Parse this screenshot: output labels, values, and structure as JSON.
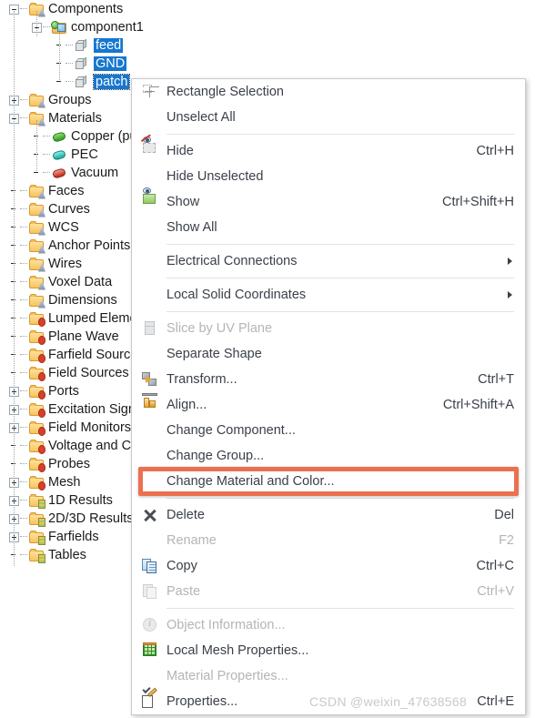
{
  "tree": {
    "items": [
      {
        "label": "Components",
        "indent": 0,
        "expander": "minus",
        "icon": "folder-cone",
        "selected": false
      },
      {
        "label": "component1",
        "indent": 1,
        "expander": "minus",
        "icon": "folder-component",
        "selected": false
      },
      {
        "label": "feed",
        "indent": 2,
        "expander": "none",
        "icon": "solid-cube",
        "selected": true
      },
      {
        "label": "GND",
        "indent": 2,
        "expander": "none",
        "icon": "solid-cube",
        "selected": true
      },
      {
        "label": "patch",
        "indent": 2,
        "expander": "none",
        "icon": "solid-cube",
        "selected": true,
        "focused": true
      },
      {
        "label": "Groups",
        "indent": 0,
        "expander": "plus",
        "icon": "folder-cone",
        "selected": false
      },
      {
        "label": "Materials",
        "indent": 0,
        "expander": "minus",
        "icon": "folder-cone",
        "selected": false
      },
      {
        "label": "Copper (pu",
        "indent": 1,
        "expander": "none",
        "icon": "material-green",
        "selected": false
      },
      {
        "label": "PEC",
        "indent": 1,
        "expander": "none",
        "icon": "material-teal",
        "selected": false
      },
      {
        "label": "Vacuum",
        "indent": 1,
        "expander": "none",
        "icon": "material-red",
        "selected": false
      },
      {
        "label": "Faces",
        "indent": 0,
        "expander": "none",
        "icon": "folder-cone",
        "selected": false
      },
      {
        "label": "Curves",
        "indent": 0,
        "expander": "none",
        "icon": "folder-cone",
        "selected": false
      },
      {
        "label": "WCS",
        "indent": 0,
        "expander": "none",
        "icon": "folder-cone",
        "selected": false
      },
      {
        "label": "Anchor Points",
        "indent": 0,
        "expander": "none",
        "icon": "folder-cone",
        "selected": false
      },
      {
        "label": "Wires",
        "indent": 0,
        "expander": "none",
        "icon": "folder-cone",
        "selected": false
      },
      {
        "label": "Voxel Data",
        "indent": 0,
        "expander": "none",
        "icon": "folder-cone",
        "selected": false
      },
      {
        "label": "Dimensions",
        "indent": 0,
        "expander": "none",
        "icon": "folder-cone",
        "selected": false
      },
      {
        "label": "Lumped Eleme",
        "indent": 0,
        "expander": "none",
        "icon": "folder-gear",
        "selected": false
      },
      {
        "label": "Plane Wave",
        "indent": 0,
        "expander": "none",
        "icon": "folder-gear",
        "selected": false
      },
      {
        "label": "Farfield Source",
        "indent": 0,
        "expander": "none",
        "icon": "folder-gear",
        "selected": false
      },
      {
        "label": "Field Sources",
        "indent": 0,
        "expander": "none",
        "icon": "folder-gear",
        "selected": false
      },
      {
        "label": "Ports",
        "indent": 0,
        "expander": "plus",
        "icon": "folder-gear",
        "selected": false
      },
      {
        "label": "Excitation Sign",
        "indent": 0,
        "expander": "plus",
        "icon": "folder-gear",
        "selected": false
      },
      {
        "label": "Field Monitors",
        "indent": 0,
        "expander": "plus",
        "icon": "folder-gear",
        "selected": false
      },
      {
        "label": "Voltage and C",
        "indent": 0,
        "expander": "none",
        "icon": "folder-gear",
        "selected": false
      },
      {
        "label": "Probes",
        "indent": 0,
        "expander": "none",
        "icon": "folder-gear",
        "selected": false
      },
      {
        "label": "Mesh",
        "indent": 0,
        "expander": "plus",
        "icon": "folder-gear",
        "selected": false
      },
      {
        "label": "1D Results",
        "indent": 0,
        "expander": "plus",
        "icon": "folder-wave",
        "selected": false
      },
      {
        "label": "2D/3D Results",
        "indent": 0,
        "expander": "plus",
        "icon": "folder-wave",
        "selected": false
      },
      {
        "label": "Farfields",
        "indent": 0,
        "expander": "plus",
        "icon": "folder-wave",
        "selected": false
      },
      {
        "label": "Tables",
        "indent": 0,
        "expander": "none",
        "icon": "folder-wave",
        "selected": false
      }
    ]
  },
  "context_menu": {
    "items": [
      {
        "kind": "item",
        "label": "Rectangle Selection",
        "shortcut": "",
        "icon": "rectangle-selection-icon",
        "disabled": false,
        "submenu": false
      },
      {
        "kind": "item",
        "label": "Unselect All",
        "shortcut": "",
        "icon": "",
        "disabled": false,
        "submenu": false
      },
      {
        "kind": "separator"
      },
      {
        "kind": "item",
        "label": "Hide",
        "shortcut": "Ctrl+H",
        "icon": "hide-icon",
        "disabled": false,
        "submenu": false
      },
      {
        "kind": "item",
        "label": "Hide Unselected",
        "shortcut": "",
        "icon": "",
        "disabled": false,
        "submenu": false
      },
      {
        "kind": "item",
        "label": "Show",
        "shortcut": "Ctrl+Shift+H",
        "icon": "show-icon",
        "disabled": false,
        "submenu": false
      },
      {
        "kind": "item",
        "label": "Show All",
        "shortcut": "",
        "icon": "",
        "disabled": false,
        "submenu": false
      },
      {
        "kind": "separator"
      },
      {
        "kind": "item",
        "label": "Electrical Connections",
        "shortcut": "",
        "icon": "",
        "disabled": false,
        "submenu": true
      },
      {
        "kind": "separator"
      },
      {
        "kind": "item",
        "label": "Local Solid Coordinates",
        "shortcut": "",
        "icon": "",
        "disabled": false,
        "submenu": true
      },
      {
        "kind": "separator"
      },
      {
        "kind": "item",
        "label": "Slice by UV Plane",
        "shortcut": "",
        "icon": "slice-icon",
        "disabled": true,
        "submenu": false
      },
      {
        "kind": "item",
        "label": "Separate Shape",
        "shortcut": "",
        "icon": "",
        "disabled": false,
        "submenu": false
      },
      {
        "kind": "item",
        "label": "Transform...",
        "shortcut": "Ctrl+T",
        "icon": "transform-icon",
        "disabled": false,
        "submenu": false
      },
      {
        "kind": "item",
        "label": "Align...",
        "shortcut": "Ctrl+Shift+A",
        "icon": "align-icon",
        "disabled": false,
        "submenu": false
      },
      {
        "kind": "item",
        "label": "Change Component...",
        "shortcut": "",
        "icon": "",
        "disabled": false,
        "submenu": false
      },
      {
        "kind": "item",
        "label": "Change Group...",
        "shortcut": "",
        "icon": "",
        "disabled": false,
        "submenu": false
      },
      {
        "kind": "item",
        "label": "Change Material and Color...",
        "shortcut": "",
        "icon": "",
        "disabled": false,
        "submenu": false,
        "highlighted": true
      },
      {
        "kind": "separator"
      },
      {
        "kind": "item",
        "label": "Delete",
        "shortcut": "Del",
        "icon": "delete-icon",
        "disabled": false,
        "submenu": false
      },
      {
        "kind": "item",
        "label": "Rename",
        "shortcut": "F2",
        "icon": "",
        "disabled": true,
        "submenu": false
      },
      {
        "kind": "item",
        "label": "Copy",
        "shortcut": "Ctrl+C",
        "icon": "copy-icon",
        "disabled": false,
        "submenu": false
      },
      {
        "kind": "item",
        "label": "Paste",
        "shortcut": "Ctrl+V",
        "icon": "paste-icon",
        "disabled": true,
        "submenu": false
      },
      {
        "kind": "separator"
      },
      {
        "kind": "item",
        "label": "Object Information...",
        "shortcut": "",
        "icon": "info-icon",
        "disabled": true,
        "submenu": false
      },
      {
        "kind": "item",
        "label": "Local Mesh Properties...",
        "shortcut": "",
        "icon": "mesh-icon",
        "disabled": false,
        "submenu": false
      },
      {
        "kind": "item",
        "label": "Material Properties...",
        "shortcut": "",
        "icon": "",
        "disabled": true,
        "submenu": false
      },
      {
        "kind": "item",
        "label": "Properties...",
        "shortcut": "Ctrl+E",
        "icon": "properties-icon",
        "disabled": false,
        "submenu": false
      }
    ]
  },
  "highlight": {
    "target_label": "Change Material and Color...",
    "color": "#ec7050"
  },
  "watermark": {
    "text": "CSDN @weixin_47638568"
  },
  "colors": {
    "selection_blue": "#1577cf",
    "highlight_orange": "#ec7050",
    "menu_text": "#3a3f49",
    "disabled_text": "#b5b5b5"
  }
}
